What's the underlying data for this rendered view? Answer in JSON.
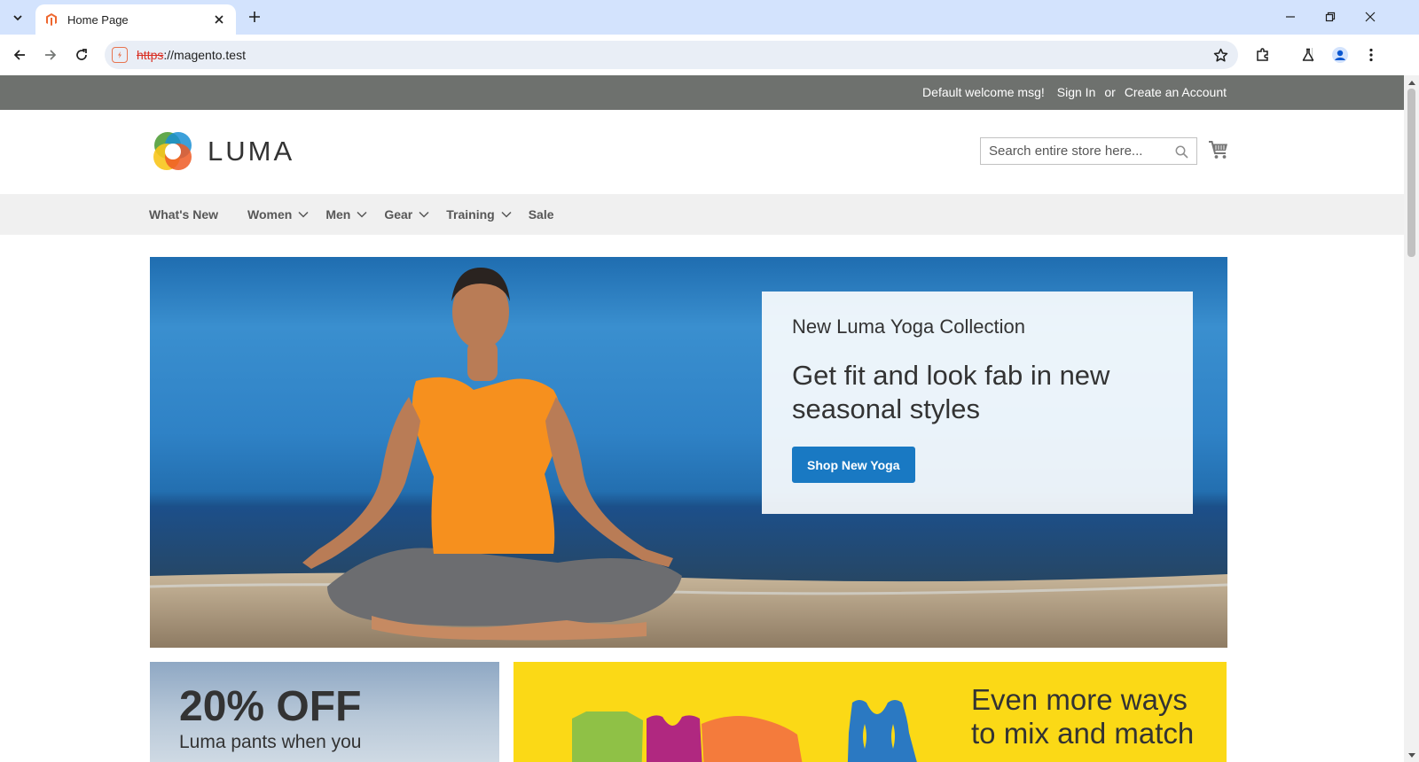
{
  "browser": {
    "tab_title": "Home Page",
    "url_scheme": "https",
    "url_rest": "://magento.test"
  },
  "page": {
    "panel": {
      "welcome": "Default welcome msg!",
      "sign_in": "Sign In",
      "or": "or",
      "create_account": "Create an Account"
    },
    "logo_text": "LUMA",
    "search_placeholder": "Search entire store here...",
    "nav": [
      {
        "label": "What's New"
      },
      {
        "label": "Women"
      },
      {
        "label": "Men"
      },
      {
        "label": "Gear"
      },
      {
        "label": "Training"
      },
      {
        "label": "Sale"
      }
    ],
    "hero": {
      "kicker": "New Luma Yoga Collection",
      "title": "Get fit and look fab in new seasonal styles",
      "button": "Shop New Yoga"
    },
    "promo_left": {
      "big": "20% OFF",
      "sub": "Luma pants when you"
    },
    "promo_right": {
      "headline": "Even more ways to mix and match"
    }
  },
  "colors": {
    "tabstrip": "#d3e3fd",
    "panel_header": "#6e716e",
    "nav_bg": "#f0f0f0",
    "primary_button": "#1979c3",
    "promo_yellow": "#fbd916"
  }
}
